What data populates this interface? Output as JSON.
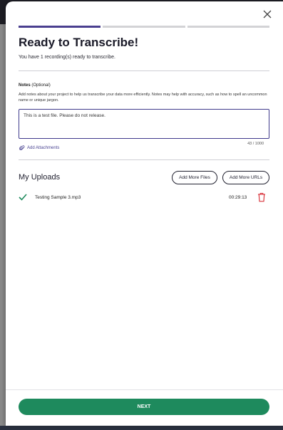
{
  "modal": {
    "title": "Ready to Transcribe!",
    "subtitle": "You have 1 recording(s) ready to transcribe.",
    "progress_steps": 3,
    "active_step": 1
  },
  "notes": {
    "label": "Notes",
    "optional": "(Optional)",
    "description": "Add notes about your project to help us transcribe your data more efficiently. Notes may help with accuracy, such as how to spell an uncommon name or unique jargon.",
    "value": "This is a test file. Please do not release.",
    "char_count": "43 / 1000"
  },
  "attachments": {
    "label": "Add Attachments"
  },
  "uploads": {
    "title": "My Uploads",
    "add_files_label": "Add More Files",
    "add_urls_label": "Add More URLs",
    "files": [
      {
        "name": "Testing Sample 3.mp3",
        "duration": "00:29:13",
        "status_icon": "check-icon"
      }
    ]
  },
  "footer": {
    "next_label": "NEXT"
  },
  "colors": {
    "accent": "#4a3f8f",
    "primary_button": "#1e8a5d",
    "check": "#1e8a5d",
    "delete": "#d9363e"
  }
}
